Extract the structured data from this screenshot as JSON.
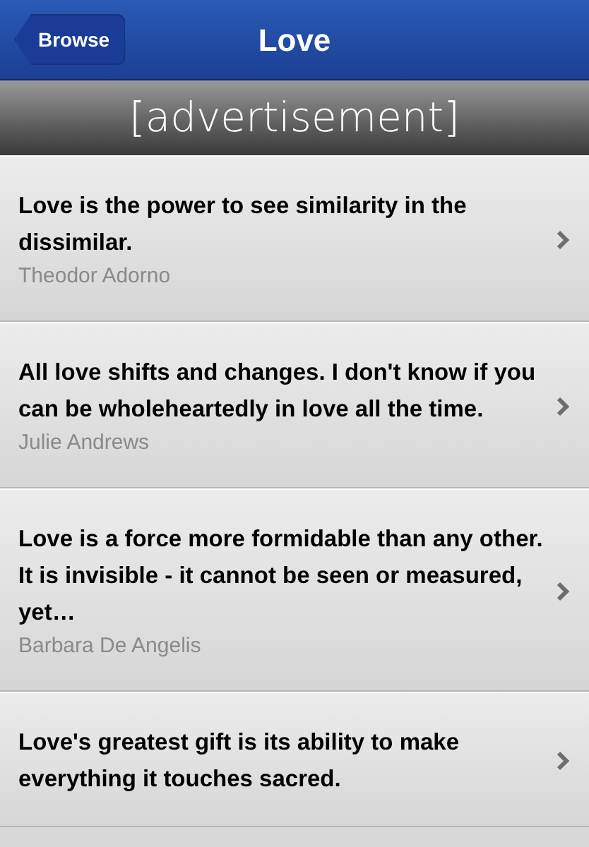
{
  "nav_bar": {
    "back_button": "Browse",
    "title": "Love"
  },
  "banner": {
    "text": "[advertisement]"
  },
  "quotes": [
    {
      "text": "Love is the power to see similarity in the dissimilar.",
      "author": "Theodor Adorno"
    },
    {
      "text": "All love shifts and changes. I don't know if you can be wholeheartedly in love all the time.",
      "author": "Julie Andrews"
    },
    {
      "text": "Love is a force more formidable than any other. It is invisible - it cannot be seen or measured, yet…",
      "author": "Barbara De Angelis"
    },
    {
      "text": "Love's greatest gift is its ability to make everything it touches sacred."
    }
  ]
}
